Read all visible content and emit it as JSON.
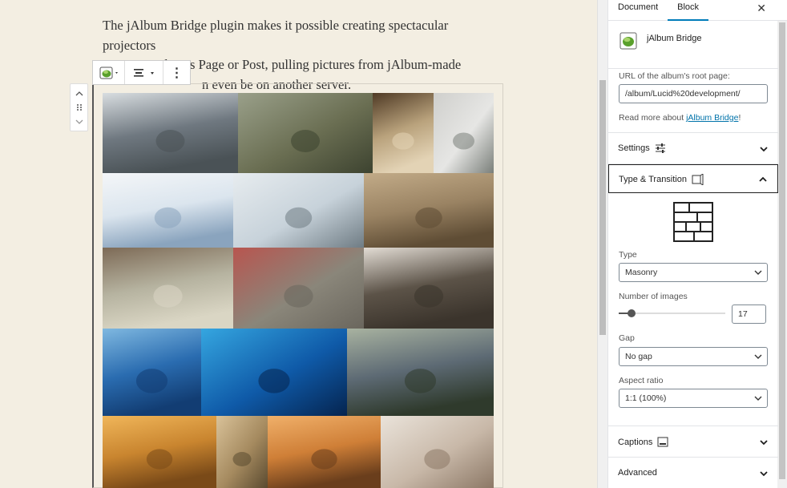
{
  "editor": {
    "paragraph": [
      "The jAlbum Bridge plugin makes it possible creating spectacular projectors",
      "in any Wordpress Page or Post, pulling pictures from jAlbum-made",
      "n even be on another server."
    ]
  },
  "toolbar": {
    "more_glyph": "⋮"
  },
  "mover": {
    "up": "︿",
    "drag": "⠿",
    "down": "﹀"
  },
  "gallery": {
    "rows": [
      {
        "tiles": [
          {
            "name": "seagulls-flock",
            "colors": [
              "#6f7880",
              "#d8dde0",
              "#4a5256"
            ]
          },
          {
            "name": "deer-stream",
            "colors": [
              "#6a6e52",
              "#9aa08a",
              "#3d4330"
            ]
          },
          {
            "name": "cat-window",
            "colors": [
              "#b9a27c",
              "#4f3a25",
              "#e3d3b5"
            ]
          },
          {
            "name": "bulldog-plant",
            "colors": [
              "#e6e6e4",
              "#cfcfcc",
              "#7a7f7a"
            ]
          }
        ]
      },
      {
        "tiles": [
          {
            "name": "seagull-beach",
            "colors": [
              "#dbe5ee",
              "#f4f6f8",
              "#8aa4be"
            ]
          },
          {
            "name": "seagulls-posts",
            "colors": [
              "#c7d2da",
              "#e7ecef",
              "#6f7c84"
            ]
          },
          {
            "name": "leopard-road",
            "colors": [
              "#9a8363",
              "#c2ab88",
              "#5f4d35"
            ]
          }
        ]
      },
      {
        "tiles": [
          {
            "name": "boat-birds",
            "colors": [
              "#b6b3a0",
              "#7d6a56",
              "#dad6c4"
            ]
          },
          {
            "name": "macaque",
            "colors": [
              "#8a867a",
              "#b8554f",
              "#6a665d"
            ]
          },
          {
            "name": "bulldog-ground",
            "colors": [
              "#5c5348",
              "#e2dcd4",
              "#3b342c"
            ]
          }
        ]
      },
      {
        "tiles": [
          {
            "name": "birds-blue-sky",
            "colors": [
              "#2a6cb0",
              "#7fb8e0",
              "#123d73"
            ]
          },
          {
            "name": "jellyfish",
            "colors": [
              "#0f5aa8",
              "#35a6e0",
              "#05244f"
            ]
          },
          {
            "name": "goat-mountain",
            "colors": [
              "#5d6a74",
              "#a8b2a0",
              "#2f3a2c"
            ]
          }
        ]
      },
      {
        "tiles": [
          {
            "name": "deer-sunset",
            "colors": [
              "#c9852f",
              "#f0b65a",
              "#7a4a18"
            ]
          },
          {
            "name": "fawn-forest",
            "colors": [
              "#a58a5f",
              "#d9c299",
              "#5a4a30"
            ]
          },
          {
            "name": "butterfly",
            "colors": [
              "#cf7f37",
              "#f0b06a",
              "#6a3e1c"
            ]
          },
          {
            "name": "pug-blanket",
            "colors": [
              "#c8b8a8",
              "#eae3da",
              "#8c7866"
            ]
          }
        ]
      }
    ]
  },
  "sidebar": {
    "tabs": [
      "Document",
      "Block"
    ],
    "active_tab": "Block",
    "close_glyph": "✕",
    "block_card": {
      "title": "jAlbum Bridge"
    },
    "url": {
      "label": "URL of the album's root page:",
      "value": "/album/Lucid%20development/",
      "read_more_prefix": "Read more about ",
      "read_more_link": "jAlbum Bridge",
      "read_more_suffix": "!"
    },
    "settings": {
      "title": "Settings"
    },
    "type_transition": {
      "title": "Type & Transition",
      "type_label": "Type",
      "type_value": "Masonry",
      "num_images_label": "Number of images",
      "num_images_value": "17",
      "num_images_slider_fraction": 0.12,
      "gap_label": "Gap",
      "gap_value": "No gap",
      "aspect_label": "Aspect ratio",
      "aspect_value": "1:1 (100%)"
    },
    "captions": {
      "title": "Captions"
    },
    "advanced": {
      "title": "Advanced"
    }
  },
  "colors": {
    "accent": "#007cba",
    "link": "#0073aa",
    "canvas": "#f3eee2"
  }
}
